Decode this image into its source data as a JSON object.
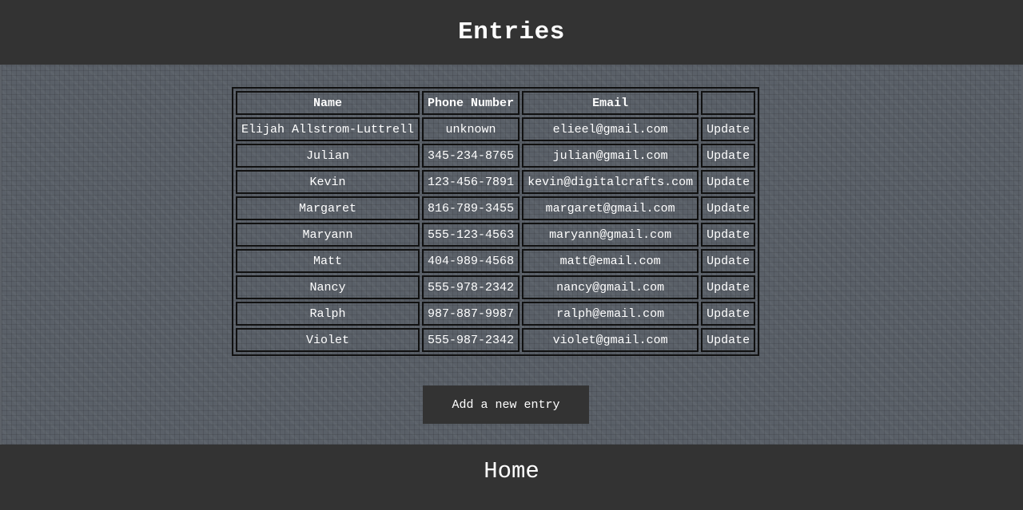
{
  "header": {
    "title": "Entries"
  },
  "table": {
    "columns": [
      "Name",
      "Phone Number",
      "Email",
      ""
    ],
    "rows": [
      {
        "name": "Elijah Allstrom-Luttrell",
        "phone": "unknown",
        "email": "elieel@gmail.com",
        "action": "Update"
      },
      {
        "name": "Julian",
        "phone": "345-234-8765",
        "email": "julian@gmail.com",
        "action": "Update"
      },
      {
        "name": "Kevin",
        "phone": "123-456-7891",
        "email": "kevin@digitalcrafts.com",
        "action": "Update"
      },
      {
        "name": "Margaret",
        "phone": "816-789-3455",
        "email": "margaret@gmail.com",
        "action": "Update"
      },
      {
        "name": "Maryann",
        "phone": "555-123-4563",
        "email": "maryann@gmail.com",
        "action": "Update"
      },
      {
        "name": "Matt",
        "phone": "404-989-4568",
        "email": "matt@email.com",
        "action": "Update"
      },
      {
        "name": "Nancy",
        "phone": "555-978-2342",
        "email": "nancy@gmail.com",
        "action": "Update"
      },
      {
        "name": "Ralph",
        "phone": "987-887-9987",
        "email": "ralph@email.com",
        "action": "Update"
      },
      {
        "name": "Violet",
        "phone": "555-987-2342",
        "email": "violet@gmail.com",
        "action": "Update"
      }
    ]
  },
  "actions": {
    "add_label": "Add a new entry"
  },
  "footer": {
    "home_label": "Home"
  },
  "colors": {
    "bar_background": "#333333",
    "content_background": "#5a6068",
    "text": "#ffffff",
    "table_border": "#111111"
  }
}
